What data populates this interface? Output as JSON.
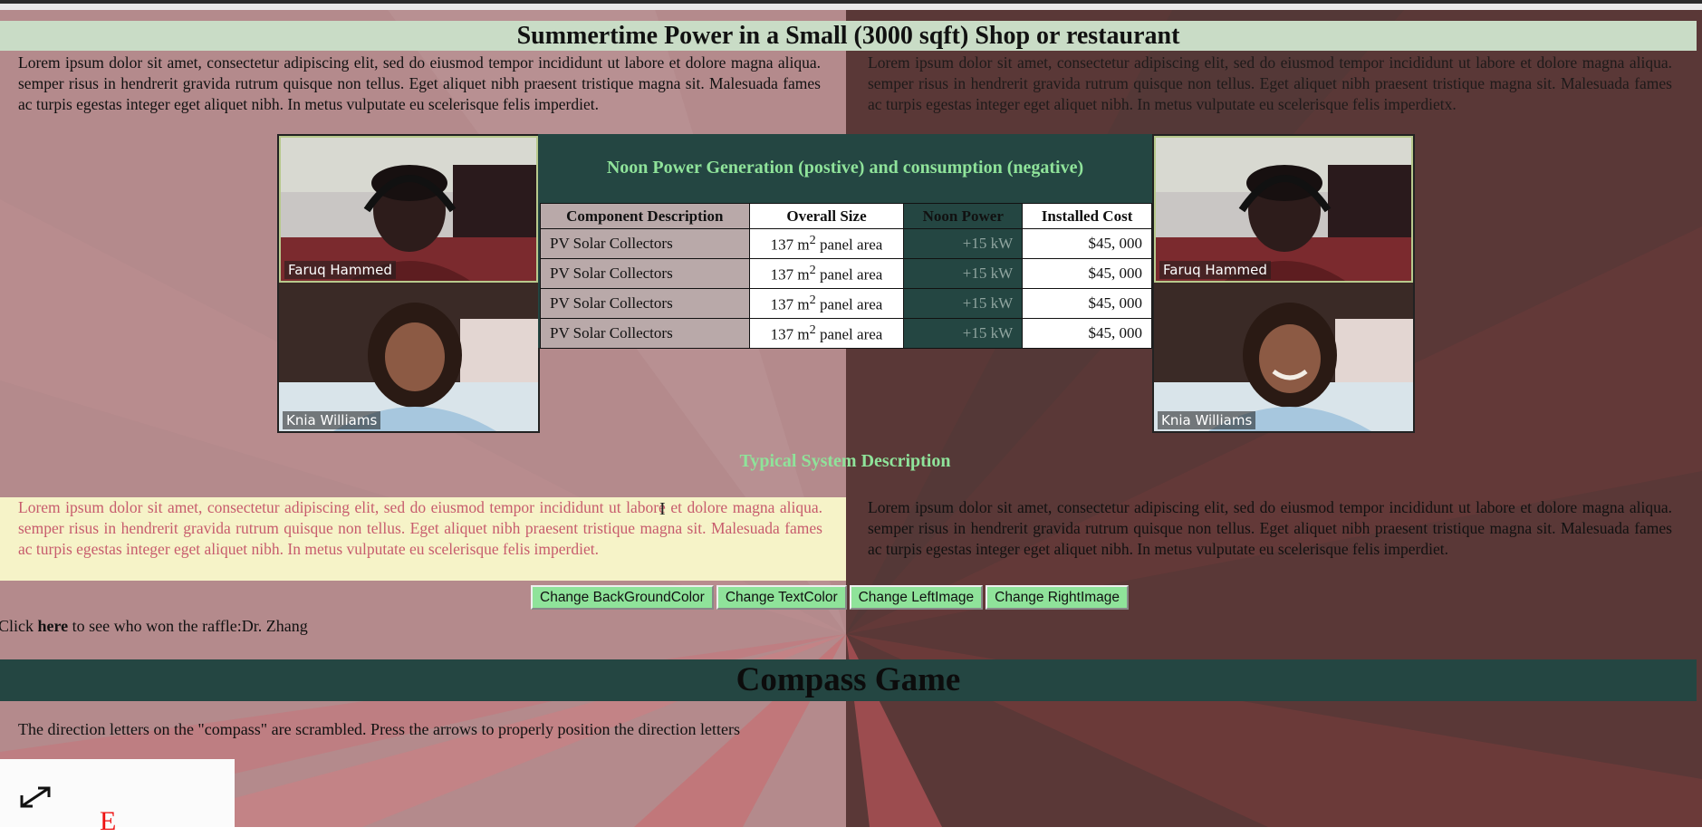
{
  "page": {
    "title": "Summertime Power in a Small (3000 sqft) Shop or restaurant",
    "lorem": "Lorem ipsum dolor sit amet, consectetur adipiscing elit, sed do eiusmod tempor incididunt ut labore et dolore magna aliqua. semper risus in hendrerit gravida rutrum quisque non tellus. Eget aliquet nibh praesent tristique magna sit. Malesuada fames ac turpis egestas integer eget aliquet nibh. In metus vulputate eu scelerisque felis imperdiet.",
    "lorem_variant": "Lorem ipsum dolor sit amet, consectetur adipiscing elit, sed do eiusmod tempor incididunt ut labore et dolore magna aliqua. semper risus in hendrerit gravida rutrum quisque non tellus. Eget aliquet nibh praesent tristique magna sit. Malesuada fames ac turpis egestas integer eget aliquet nibh. In metus vulputate eu scelerisque felis imperdietx."
  },
  "video_left": {
    "top_name": "Faruq Hammed",
    "bottom_name": "Knia Williams"
  },
  "video_right": {
    "top_name": "Faruq Hammed",
    "bottom_name": "Knia Williams"
  },
  "table": {
    "title": "Noon Power Generation (postive) and consumption (negative)",
    "headers": [
      "Component Description",
      "Overall Size",
      "Noon Power",
      "Installed Cost"
    ],
    "rows": [
      {
        "desc": "PV Solar Collectors",
        "size_prefix": "137 m",
        "size_sup": "2",
        "size_suffix": " panel area",
        "power": "+15 kW",
        "cost": "$45, 000"
      },
      {
        "desc": "PV Solar Collectors",
        "size_prefix": "137 m",
        "size_sup": "2",
        "size_suffix": " panel area",
        "power": "+15 kW",
        "cost": "$45, 000"
      },
      {
        "desc": "PV Solar Collectors",
        "size_prefix": "137 m",
        "size_sup": "2",
        "size_suffix": " panel area",
        "power": "+15 kW",
        "cost": "$45, 000"
      },
      {
        "desc": "PV Solar Collectors",
        "size_prefix": "137 m",
        "size_sup": "2",
        "size_suffix": " panel area",
        "power": "+15 kW",
        "cost": "$45, 000"
      }
    ]
  },
  "subheading": "Typical System Description",
  "buttons": {
    "bg": "Change BackGroundColor",
    "text": "Change TextColor",
    "left_image": "Change LeftImage",
    "right_image": "Change RightImage"
  },
  "raffle": {
    "prefix": "Click ",
    "link": "here",
    "suffix": " to see who won the raffle:Dr. Zhang"
  },
  "compass": {
    "title": "Compass Game",
    "description": "The direction letters on the \"compass\" are scrambled. Press the arrows to properly position the direction letters",
    "visible_letter": "E"
  },
  "colors": {
    "title_bar": "#c9dcc6",
    "dark_panel": "#244642",
    "accent_green": "#8fe39a",
    "left_bg": "#b48a8c",
    "right_bg": "#5a3837",
    "cream": "#f6f3c8",
    "pink_text": "#c75c6d"
  }
}
